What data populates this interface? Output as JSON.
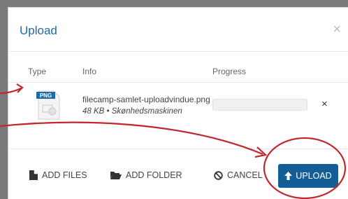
{
  "dialog": {
    "title": "Upload",
    "close_label": "×"
  },
  "table": {
    "headers": {
      "type": "Type",
      "info": "Info",
      "progress": "Progress"
    },
    "rows": [
      {
        "type_badge": "PNG",
        "filename": "filecamp-samlet-uploadvindue.png",
        "meta": "48 KB • Skønhedsmaskinen",
        "progress": 0,
        "remove_label": "×"
      }
    ]
  },
  "footer": {
    "add_files": "ADD FILES",
    "add_folder": "ADD FOLDER",
    "cancel": "CANCEL",
    "upload": "UPLOAD"
  },
  "colors": {
    "accent": "#1f6aa5",
    "upload_button": "#135e97",
    "annotation": "#c0282d"
  }
}
